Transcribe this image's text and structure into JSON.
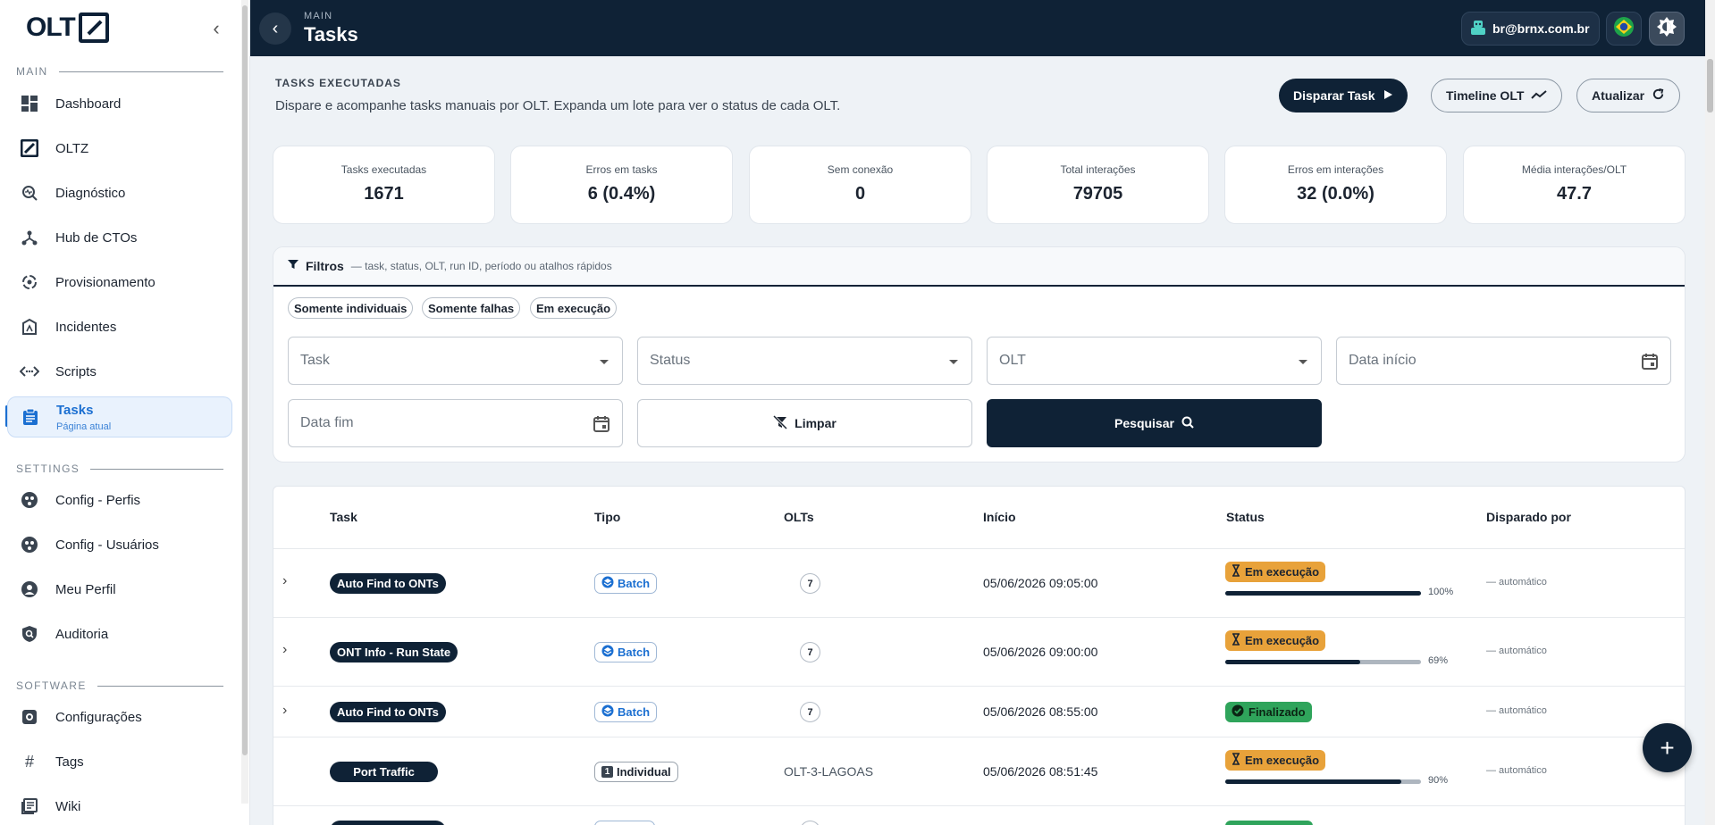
{
  "brand": {
    "logo_text": "OLT"
  },
  "sidebar": {
    "sections": {
      "main": "MAIN",
      "settings": "SETTINGS",
      "software": "SOFTWARE"
    },
    "items": [
      {
        "label": "Dashboard",
        "icon": "dashboard-icon"
      },
      {
        "label": "OLTZ",
        "icon": "oltz-logo-icon"
      },
      {
        "label": "Diagnóstico",
        "icon": "diagnostic-search-icon"
      },
      {
        "label": "Hub de CTOs",
        "icon": "hub-icon"
      },
      {
        "label": "Provisionamento",
        "icon": "provisioning-icon"
      },
      {
        "label": "Incidentes",
        "icon": "incident-icon"
      },
      {
        "label": "Scripts",
        "icon": "code-icon"
      },
      {
        "label": "Tasks",
        "icon": "clipboard-icon",
        "sub": "Página atual"
      },
      {
        "label": "Config - Perfis",
        "icon": "profiles-icon"
      },
      {
        "label": "Config - Usuários",
        "icon": "users-config-icon"
      },
      {
        "label": "Meu Perfil",
        "icon": "profile-icon"
      },
      {
        "label": "Auditoria",
        "icon": "audit-shield-icon"
      },
      {
        "label": "Configurações",
        "icon": "settings-icon"
      },
      {
        "label": "Tags",
        "icon": "hash-icon"
      },
      {
        "label": "Wiki",
        "icon": "wiki-icon"
      }
    ]
  },
  "topbar": {
    "crumb": "MAIN",
    "title": "Tasks",
    "user": "br@brnx.com.br"
  },
  "header": {
    "kicker": "TASKS EXECUTADAS",
    "description": "Dispare e acompanhe tasks manuais por OLT. Expanda um lote para ver o status de cada OLT.",
    "buttons": {
      "dispatch": "Disparar Task",
      "timeline": "Timeline OLT",
      "refresh": "Atualizar"
    }
  },
  "stats": [
    {
      "label": "Tasks executadas",
      "value": "1671"
    },
    {
      "label": "Erros em tasks",
      "value": "6 (0.4%)"
    },
    {
      "label": "Sem conexão",
      "value": "0"
    },
    {
      "label": "Total interações",
      "value": "79705"
    },
    {
      "label": "Erros em interações",
      "value": "32 (0.0%)"
    },
    {
      "label": "Média interações/OLT",
      "value": "47.7"
    }
  ],
  "filters": {
    "title": "Filtros",
    "subtitle": "— task, status, OLT, run ID, período ou atalhos rápidos",
    "chips": [
      "Somente individuais",
      "Somente falhas",
      "Em execução"
    ],
    "task_placeholder": "Task",
    "status_placeholder": "Status",
    "olt_placeholder": "OLT",
    "date_start_placeholder": "Data início",
    "date_end_placeholder": "Data fim",
    "clear_label": "Limpar",
    "search_label": "Pesquisar"
  },
  "table": {
    "headers": {
      "task": "Task",
      "tipo": "Tipo",
      "olts": "OLTs",
      "inicio": "Início",
      "status": "Status",
      "disparado": "Disparado por"
    },
    "rows": [
      {
        "task": "Auto Find to ONTs",
        "tipo": "Batch",
        "olts": "7",
        "inicio": "05/06/2026 09:05:00",
        "status": "Em execução",
        "progress_pct": "100%",
        "progress": 1.0,
        "by": "— automático"
      },
      {
        "task": "ONT Info - Run State",
        "tipo": "Batch",
        "olts": "7",
        "inicio": "05/06/2026 09:00:00",
        "status": "Em execução",
        "progress_pct": "69%",
        "progress": 0.69,
        "by": "— automático"
      },
      {
        "task": "Auto Find to ONTs",
        "tipo": "Batch",
        "olts": "7",
        "inicio": "05/06/2026 08:55:00",
        "status": "Finalizado",
        "by": "— automático"
      },
      {
        "task": "Port Traffic",
        "tipo": "Individual",
        "tipo_badge": "1",
        "olts": "OLT-3-LAGOAS",
        "inicio": "05/06/2026 08:51:45",
        "status": "Em execução",
        "progress_pct": "90%",
        "progress": 0.9,
        "by": "— automático"
      }
    ]
  },
  "colors": {
    "navy": "#0f2236",
    "accent": "#1b6fd1",
    "running": "#e8a23a",
    "done": "#2fa45b"
  }
}
